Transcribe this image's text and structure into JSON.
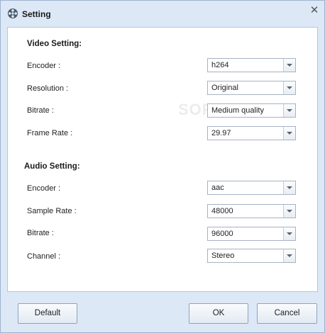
{
  "window": {
    "title": "Setting",
    "close_glyph": "✕",
    "title_icon": "film-reel-icon"
  },
  "video": {
    "heading": "Video Setting:",
    "rows": [
      {
        "label": "Encoder :",
        "value": "h264"
      },
      {
        "label": "Resolution :",
        "value": "Original"
      },
      {
        "label": "Bitrate :",
        "value": "Medium quality"
      },
      {
        "label": "Frame Rate :",
        "value": "29.97"
      }
    ]
  },
  "audio": {
    "heading": "Audio Setting:",
    "rows": [
      {
        "label": "Encoder :",
        "value": "aac"
      },
      {
        "label": "Sample Rate :",
        "value": "48000"
      },
      {
        "label": "Bitrate :",
        "value": "96000"
      },
      {
        "label": "Channel :",
        "value": "Stereo"
      }
    ]
  },
  "buttons": {
    "default": "Default",
    "ok": "OK",
    "cancel": "Cancel"
  },
  "watermark": "SOFTPEDIA"
}
